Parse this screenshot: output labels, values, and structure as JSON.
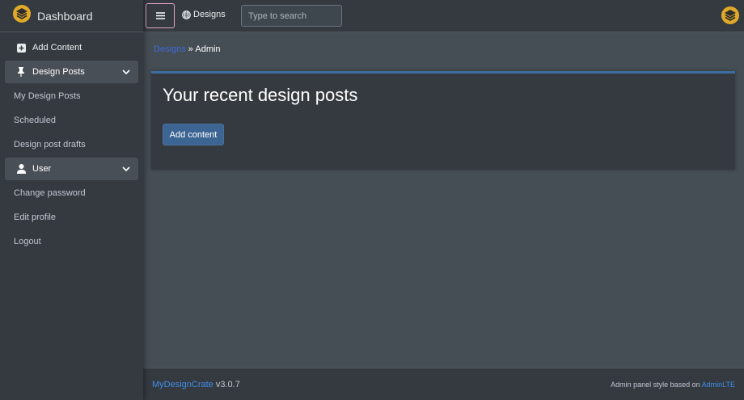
{
  "brand": {
    "title": "Dashboard",
    "logo_icon": "layers-logo-icon"
  },
  "sidebar": {
    "items": [
      {
        "label": "Add Content",
        "icon": "plus-square-icon"
      },
      {
        "label": "Design Posts",
        "icon": "pin-icon",
        "expanded": true
      },
      {
        "label": "My Design Posts"
      },
      {
        "label": "Scheduled"
      },
      {
        "label": "Design post drafts"
      },
      {
        "label": "User",
        "icon": "user-icon",
        "expanded": true
      },
      {
        "label": "Change password"
      },
      {
        "label": "Edit profile"
      },
      {
        "label": "Logout"
      }
    ]
  },
  "navbar": {
    "menu_icon": "hamburger-menu-icon",
    "link_label": "Designs",
    "link_icon": "globe-icon",
    "search_placeholder": "Type to search"
  },
  "breadcrumb": {
    "link": "Designs",
    "separator": " » ",
    "current": "Admin"
  },
  "card": {
    "title": "Your recent design posts",
    "button_label": "Add content"
  },
  "footer": {
    "app_name": "MyDesignCrate",
    "version": " v3.0.7",
    "credit_text": "Admin panel style based on ",
    "credit_link": "AdminLTE"
  },
  "colors": {
    "sidebar_bg": "#343a40",
    "content_bg": "#454d55",
    "accent": "#3d6593",
    "link": "#3f8ee8",
    "logo_yellow": "#f0b429"
  }
}
